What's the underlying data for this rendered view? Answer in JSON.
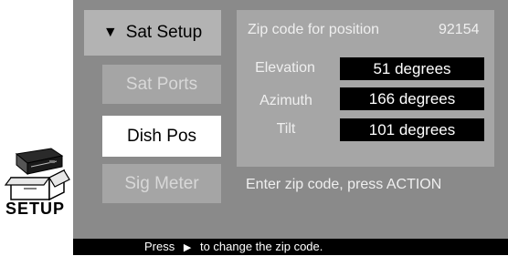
{
  "menu": {
    "items": [
      {
        "label": "Sat Setup",
        "state": "header",
        "icon": "triangle-down-icon"
      },
      {
        "label": "Sat Ports",
        "state": "dim"
      },
      {
        "label": "Dish Pos",
        "state": "selected"
      },
      {
        "label": "Sig Meter",
        "state": "dim"
      }
    ]
  },
  "panel": {
    "zip_label": "Zip code for position",
    "zip_value": "92154",
    "rows": [
      {
        "label": "Elevation",
        "value": "51 degrees"
      },
      {
        "label": "Azimuth",
        "value": "166 degrees"
      },
      {
        "label": "Tilt",
        "value": "101 degrees"
      }
    ],
    "prompt": "Enter zip code, press ACTION"
  },
  "status": {
    "before": "Press",
    "after": "to change the zip code.",
    "icon": "play-arrow-icon"
  },
  "setup_icon": {
    "label": "SETUP",
    "icon": "receiver-box-icon"
  },
  "colors": {
    "screen_bg": "#8a8a8a",
    "panel_bg": "#a6a6a6",
    "value_box_bg": "#000000"
  }
}
